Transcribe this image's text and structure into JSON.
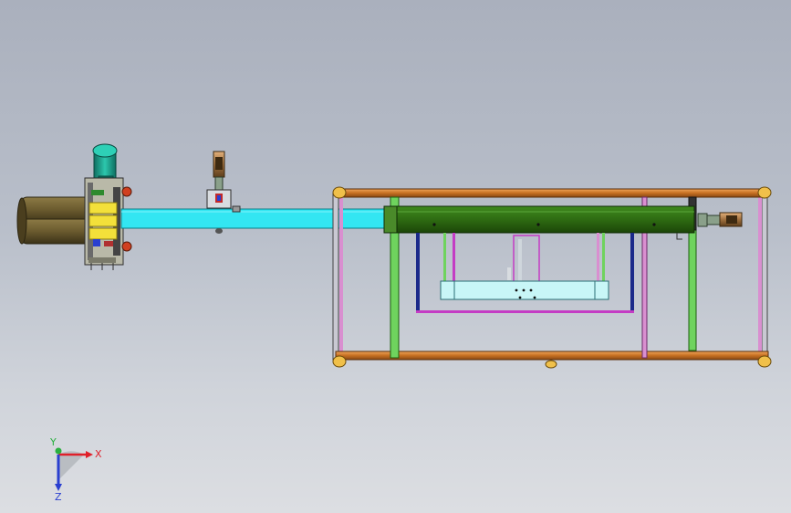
{
  "viewport": {
    "background_top": "#aab0bd",
    "background_bottom": "#dcdee2"
  },
  "model": {
    "parts": [
      "motor-assembly",
      "twin-cylinder-tank",
      "gearbox-plate",
      "cyan-conveyor-beam",
      "clamp-cylinder",
      "rectangular-frame",
      "green-rail",
      "carriage",
      "end-cylinder"
    ],
    "colors": {
      "beam": "#33e6f2",
      "frame_rail": "#d27a2a",
      "green_rail": "#2e6b12",
      "pink_post": "#d98fd0",
      "magenta_frame": "#c43cc4",
      "navy_post": "#1b2a8a",
      "light_green_post": "#6fd35e",
      "motor": "#1aa58f",
      "tank": "#6a5a2e",
      "carriage_panel": "#c8f6f7"
    }
  },
  "triad": {
    "x_label": "X",
    "y_label": "Y",
    "z_label": "Z",
    "x_color": "#e0202a",
    "y_color": "#2ab040",
    "z_color": "#2a3fd0"
  }
}
